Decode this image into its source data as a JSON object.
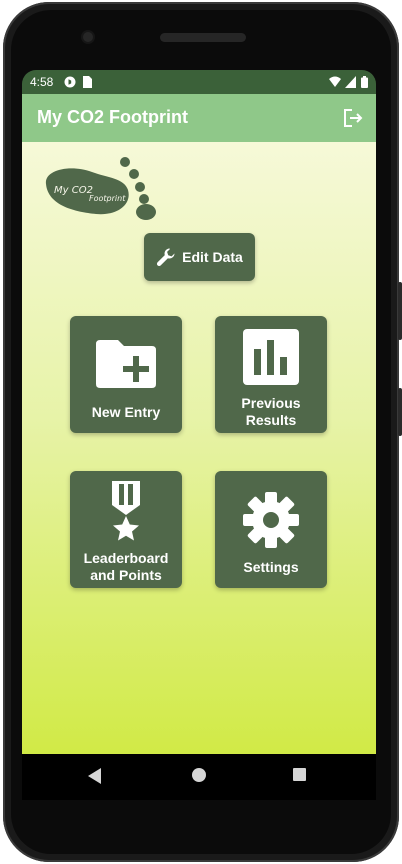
{
  "status": {
    "time": "4:58"
  },
  "app": {
    "title": "My CO2 Footprint"
  },
  "logo": {
    "line1": "My CO2",
    "line2": "Footprint"
  },
  "actions": {
    "edit_data": "Edit Data"
  },
  "tiles": [
    {
      "label": "New Entry",
      "icon": "folder-plus-icon"
    },
    {
      "label": "Previous\nResults",
      "icon": "bar-chart-icon"
    },
    {
      "label": "Leaderboard\nand Points",
      "icon": "medal-icon"
    },
    {
      "label": "Settings",
      "icon": "gear-icon"
    }
  ],
  "colors": {
    "statusbar": "#3b6139",
    "toolbar": "#8fc889",
    "tile": "#50684a",
    "gradient_top": "#f6f9d8",
    "gradient_bottom": "#d1ea46"
  }
}
